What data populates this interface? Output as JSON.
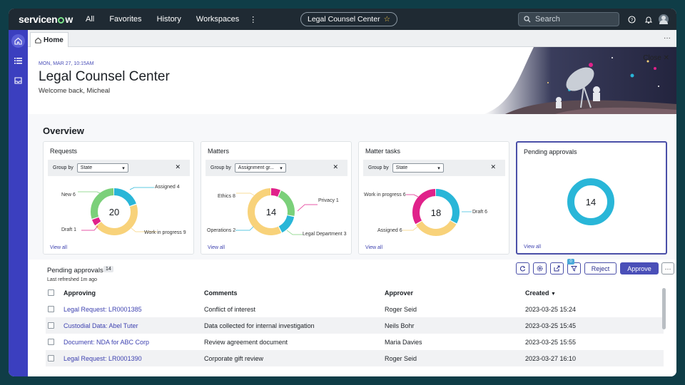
{
  "app": {
    "brand": "servicenow",
    "colors": {
      "accent": "#4a4fb8",
      "topbar": "#1f2a33",
      "sidebar": "#3b3fbf"
    }
  },
  "topnav": {
    "items": [
      "All",
      "Favorites",
      "History",
      "Workspaces"
    ],
    "center_pill": "Legal Counsel Center",
    "search_placeholder": "Search"
  },
  "tabs": {
    "home": "Home"
  },
  "hero": {
    "date": "MON, MAR 27, 10:15AM",
    "title": "Legal Counsel Center",
    "welcome": "Welcome back, Micheal",
    "close": "Close"
  },
  "overview": {
    "title": "Overview"
  },
  "cards": [
    {
      "title": "Requests",
      "group_label": "Group by",
      "group_value": "State",
      "total": "20",
      "view_all": "View all",
      "segments": [
        {
          "label": "Assigned",
          "value": 4,
          "color": "#29b6d8"
        },
        {
          "label": "Work in progress",
          "value": 9,
          "color": "#f8d27a"
        },
        {
          "label": "Draft",
          "value": 1,
          "color": "#e0218a"
        },
        {
          "label": "New",
          "value": 6,
          "color": "#7bd07a"
        }
      ]
    },
    {
      "title": "Matters",
      "group_label": "Group by",
      "group_value": "Assignment gr...",
      "total": "14",
      "view_all": "View all",
      "segments": [
        {
          "label": "Privacy",
          "value": 1,
          "color": "#e0218a"
        },
        {
          "label": "Legal Department",
          "value": 3,
          "color": "#7bd07a"
        },
        {
          "label": "Operations",
          "value": 2,
          "color": "#29b6d8"
        },
        {
          "label": "Ethics",
          "value": 8,
          "color": "#f8d27a"
        }
      ]
    },
    {
      "title": "Matter tasks",
      "group_label": "Group by",
      "group_value": "State",
      "total": "18",
      "view_all": "View all",
      "segments": [
        {
          "label": "Draft",
          "value": 6,
          "color": "#29b6d8"
        },
        {
          "label": "Assigned",
          "value": 6,
          "color": "#f8d27a"
        },
        {
          "label": "Work in progress",
          "value": 6,
          "color": "#e0218a"
        }
      ]
    },
    {
      "title": "Pending approvals",
      "total": "14",
      "view_all": "View all",
      "segments": [
        {
          "label": "",
          "value": 14,
          "color": "#29b6d8"
        }
      ]
    }
  ],
  "approvals": {
    "title": "Pending approvals",
    "count": "14",
    "refreshed": "Last refreshed 1m ago",
    "filter_count": "0",
    "reject": "Reject",
    "approve": "Approve",
    "columns": [
      "Approving",
      "Comments",
      "Approver",
      "Created"
    ],
    "rows": [
      [
        "Legal Request: LR0001385",
        "Conflict of interest",
        "Roger Seid",
        "2023-03-25 15:24"
      ],
      [
        "Custodial Data: Abel Tuter",
        "Data collected for internal investigation",
        "Neils Bohr",
        "2023-03-25 15:45"
      ],
      [
        "Document: NDA for ABC Corp",
        "Review agreement document",
        "Maria Davies",
        "2023-03-25 15:55"
      ],
      [
        "Legal Request: LR0001390",
        "Corporate gift review",
        "Roger Seid",
        "2023-03-27 16:10"
      ]
    ]
  }
}
